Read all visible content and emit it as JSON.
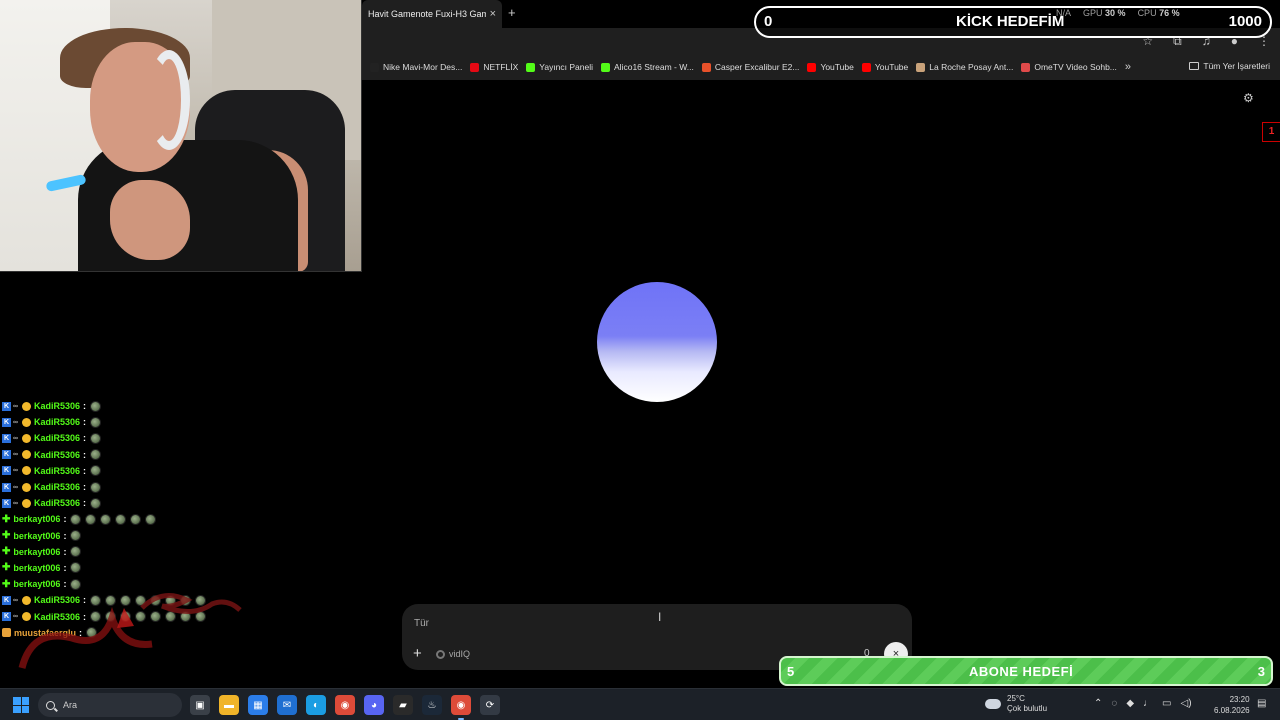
{
  "browser": {
    "tab_title": "Havit Gamenote Fuxi-H3 Gamin",
    "tab_close": "×",
    "new_tab": "+",
    "bookmarks": [
      {
        "label": "Nike Mavi-Mor Des...",
        "color": "#222222"
      },
      {
        "label": "NETFLİX",
        "color": "#e50914"
      },
      {
        "label": "Yayıncı Paneli",
        "color": "#53fc18"
      },
      {
        "label": "Alico16 Stream - W...",
        "color": "#53fc18"
      },
      {
        "label": "Casper Excalibur E2...",
        "color": "#e8512a"
      },
      {
        "label": "YouTube",
        "color": "#ff0000"
      },
      {
        "label": "YouTube",
        "color": "#ff0000"
      },
      {
        "label": "La Roche Posay Ant...",
        "color": "#c9a27a"
      },
      {
        "label": "OmeTV Video Sohb...",
        "color": "#e04a4a"
      }
    ],
    "bookmarks_more": "»",
    "all_bookmarks": "Tüm Yer İşaretleri"
  },
  "overlay": {
    "kick_goal": {
      "current": "0",
      "title": "KİCK HEDEFİM",
      "target": "1000"
    },
    "perf": {
      "gpu_label": "GPU",
      "gpu_value": "30 %",
      "cpu_label": "CPU",
      "cpu_value": "76 %",
      "na_value": "N/A"
    },
    "sub_goal": {
      "current": "5",
      "title": "ABONE HEDEFİ",
      "target": "3"
    }
  },
  "prompt": {
    "placeholder": "Tür",
    "vidiq_label": "vidIQ",
    "count": "0",
    "close": "×",
    "plus": "+"
  },
  "page": {
    "red_tab_label": "1"
  },
  "chat": {
    "messages": [
      {
        "user": "KadiR5306",
        "color": "#53fc18",
        "style": "kick",
        "emotes": 1
      },
      {
        "user": "KadiR5306",
        "color": "#53fc18",
        "style": "kick",
        "emotes": 1
      },
      {
        "user": "KadiR5306",
        "color": "#53fc18",
        "style": "kick",
        "emotes": 1
      },
      {
        "user": "KadiR5306",
        "color": "#53fc18",
        "style": "kick",
        "emotes": 1
      },
      {
        "user": "KadiR5306",
        "color": "#53fc18",
        "style": "kick",
        "emotes": 1
      },
      {
        "user": "KadiR5306",
        "color": "#53fc18",
        "style": "kick",
        "emotes": 1
      },
      {
        "user": "KadiR5306",
        "color": "#53fc18",
        "style": "kick",
        "emotes": 1
      },
      {
        "user": "berkayt006",
        "color": "#53fc18",
        "style": "plus",
        "emotes": 6
      },
      {
        "user": "berkayt006",
        "color": "#53fc18",
        "style": "plus",
        "emotes": 1
      },
      {
        "user": "berkayt006",
        "color": "#53fc18",
        "style": "plus",
        "emotes": 1
      },
      {
        "user": "berkayt006",
        "color": "#53fc18",
        "style": "plus",
        "emotes": 1
      },
      {
        "user": "berkayt006",
        "color": "#53fc18",
        "style": "plus",
        "emotes": 1
      },
      {
        "user": "KadiR5306",
        "color": "#53fc18",
        "style": "kick",
        "emotes": 8
      },
      {
        "user": "KadiR5306",
        "color": "#53fc18",
        "style": "kick",
        "emotes": 8
      },
      {
        "user": "muustafaerglu",
        "color": "#e8a33a",
        "style": "sub",
        "emotes": 1
      }
    ],
    "separator": ":"
  },
  "taskbar": {
    "search_label": "Ara",
    "weather_temp": "25°C",
    "weather_desc": "Çok bulutlu",
    "time": "23:20",
    "date": "6.08.2026",
    "apps": [
      {
        "name": "task-view-icon",
        "glyph": "▣",
        "color": "#3a4048"
      },
      {
        "name": "file-explorer-icon",
        "glyph": "▬",
        "color": "#f0b429"
      },
      {
        "name": "store-icon",
        "glyph": "▦",
        "color": "#2b7de9"
      },
      {
        "name": "mail-icon",
        "glyph": "✉",
        "color": "#1f6fd1"
      },
      {
        "name": "edge-icon",
        "glyph": "◐",
        "color": "#1b9de2"
      },
      {
        "name": "chrome-icon",
        "glyph": "◉",
        "color": "#dd4b39"
      },
      {
        "name": "discord-icon",
        "glyph": "◕",
        "color": "#5865f2"
      },
      {
        "name": "obs-icon",
        "glyph": "▰",
        "color": "#2a2a2a"
      },
      {
        "name": "steam-icon",
        "glyph": "♨",
        "color": "#1b2838"
      },
      {
        "name": "chrome-active-icon",
        "glyph": "◉",
        "color": "#dd4b39"
      },
      {
        "name": "app-icon",
        "glyph": "⟳",
        "color": "#333a44"
      }
    ]
  }
}
